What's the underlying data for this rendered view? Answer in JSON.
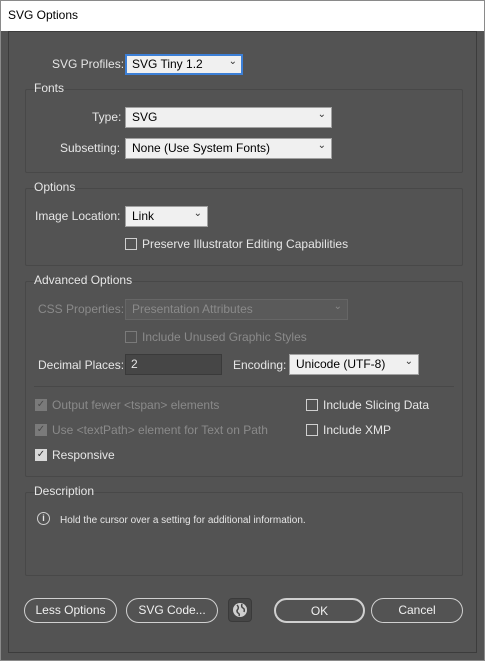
{
  "window": {
    "title": "SVG Options"
  },
  "svg_profiles": {
    "label": "SVG Profiles:",
    "value": "SVG Tiny 1.2"
  },
  "fonts": {
    "title": "Fonts",
    "type_label": "Type:",
    "type_value": "SVG",
    "subsetting_label": "Subsetting:",
    "subsetting_value": "None (Use System Fonts)"
  },
  "options": {
    "title": "Options",
    "image_location_label": "Image Location:",
    "image_location_value": "Link",
    "preserve_label": "Preserve Illustrator Editing Capabilities",
    "preserve_checked": false
  },
  "advanced": {
    "title": "Advanced Options",
    "css_label": "CSS Properties:",
    "css_value": "Presentation Attributes",
    "unused_styles_label": "Include Unused Graphic Styles",
    "decimal_label": "Decimal Places:",
    "decimal_value": "2",
    "encoding_label": "Encoding:",
    "encoding_value": "Unicode (UTF-8)",
    "fewer_tspan_label": "Output fewer <tspan> elements",
    "textpath_label": "Use <textPath> element for Text on Path",
    "responsive_label": "Responsive",
    "slicing_label": "Include Slicing Data",
    "xmp_label": "Include XMP"
  },
  "description": {
    "title": "Description",
    "text": "Hold the cursor over a setting for additional information."
  },
  "buttons": {
    "less_options": "Less Options",
    "svg_code": "SVG Code...",
    "ok": "OK",
    "cancel": "Cancel"
  },
  "icons": {
    "chevron": "chevron-down-icon",
    "check": "check-icon",
    "info": "info-icon",
    "globe": "globe-icon"
  }
}
